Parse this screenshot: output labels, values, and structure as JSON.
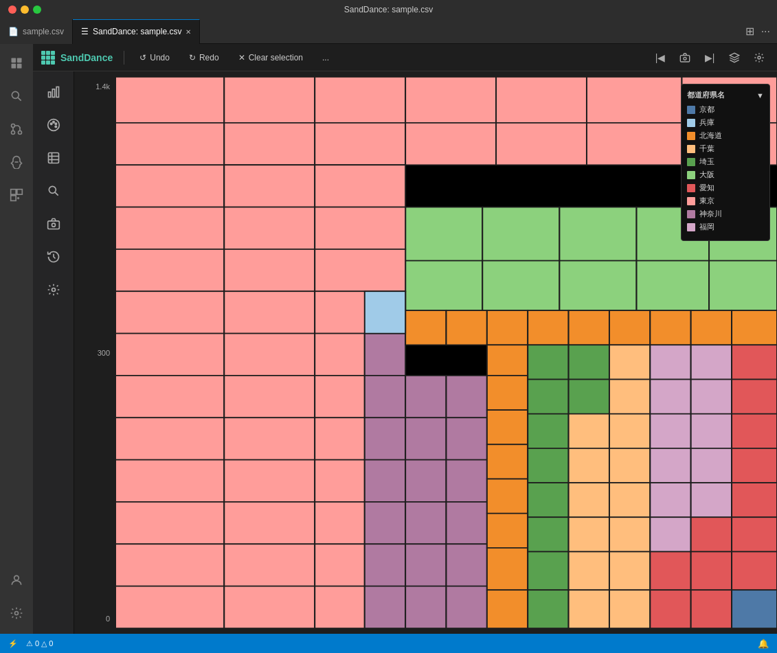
{
  "titleBar": {
    "title": "SandDance: sample.csv"
  },
  "tabs": [
    {
      "id": "sample-csv",
      "label": "sample.csv",
      "icon": "📄",
      "active": false,
      "closeable": false
    },
    {
      "id": "sanddance",
      "label": "SandDance: sample.csv",
      "icon": "☰",
      "active": true,
      "closeable": true
    }
  ],
  "toolbar": {
    "logo": "SandDance",
    "undoLabel": "Undo",
    "redoLabel": "Redo",
    "clearSelectionLabel": "Clear selection",
    "moreLabel": "..."
  },
  "yAxis": {
    "values": [
      "1.4k",
      "300",
      "0"
    ]
  },
  "legend": {
    "title": "都道府県名",
    "filterIcon": "▼",
    "items": [
      {
        "label": "京都",
        "color": "#4e79a7"
      },
      {
        "label": "兵庫",
        "color": "#a0cbe8"
      },
      {
        "label": "北海道",
        "color": "#f28e2b"
      },
      {
        "label": "千葉",
        "color": "#ffbe7d"
      },
      {
        "label": "埼玉",
        "color": "#59a14f"
      },
      {
        "label": "大阪",
        "color": "#8cd17d"
      },
      {
        "label": "愛知",
        "color": "#e15759"
      },
      {
        "label": "東京",
        "color": "#ff9d9a"
      },
      {
        "label": "神奈川",
        "color": "#b07aa1"
      },
      {
        "label": "福岡",
        "color": "#d4a6c8"
      }
    ]
  },
  "statusBar": {
    "errors": "0",
    "warnings": "0",
    "leftLabel": "⚠ 0 △ 0"
  },
  "activityBar": {
    "icons": [
      "explorer",
      "search",
      "git",
      "debug",
      "extensions",
      "account",
      "settings"
    ]
  },
  "sdSidebar": {
    "icons": [
      "chart-bar",
      "palette",
      "table",
      "search",
      "camera",
      "history",
      "gear"
    ]
  }
}
